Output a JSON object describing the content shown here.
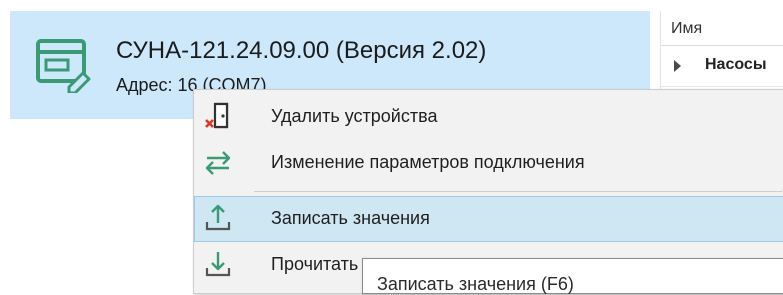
{
  "device": {
    "title": "СУНА-121.24.09.00 (Версия 2.02)",
    "address": "Адрес: 16 (COM7)",
    "icon": "device-edit-icon",
    "accent": "#3a9a74"
  },
  "grid": {
    "header": "Имя",
    "rows": [
      {
        "label": "Насосы"
      }
    ]
  },
  "context_menu": {
    "items": [
      {
        "label": "Удалить устройства",
        "icon": "delete-device-icon"
      },
      {
        "label": "Изменение параметров подключения",
        "icon": "swap-arrows-icon"
      },
      {
        "label": "Записать значения",
        "icon": "upload-icon"
      },
      {
        "label": "Прочитать",
        "icon": "download-icon"
      }
    ]
  },
  "tooltip": {
    "text": "Записать значения (F6)"
  },
  "colors": {
    "selection": "#cde8fb",
    "menu_highlight": "#cfe6f3",
    "icon_green": "#3a9a74",
    "icon_red": "#d93a2b"
  }
}
